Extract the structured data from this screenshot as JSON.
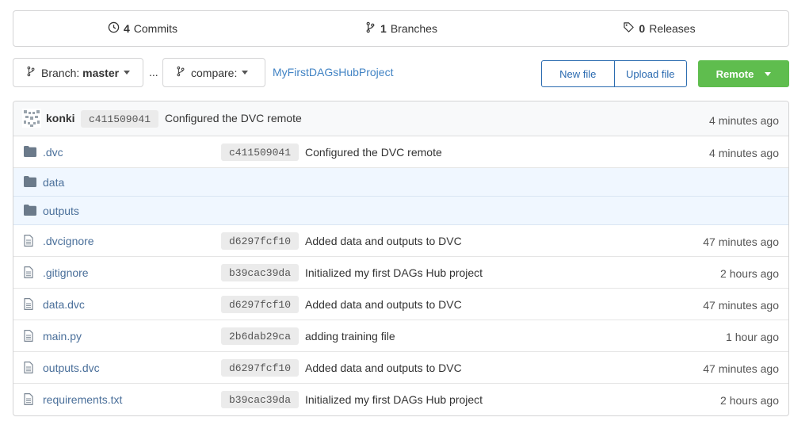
{
  "stats": {
    "commits_count": "4",
    "commits_label": "Commits",
    "branches_count": "1",
    "branches_label": "Branches",
    "releases_count": "0",
    "releases_label": "Releases"
  },
  "toolbar": {
    "branch_prefix": "Branch:",
    "branch_name": "master",
    "ellipsis": "...",
    "compare_label": "compare:",
    "repo_name": "MyFirstDAGsHubProject",
    "new_file": "New file",
    "upload_file": "Upload file",
    "remote": "Remote"
  },
  "latest_commit": {
    "author": "konki",
    "sha": "c411509041",
    "message": "Configured the DVC remote",
    "time": "4 minutes ago"
  },
  "files": [
    {
      "type": "folder",
      "name": ".dvc",
      "sha": "c411509041",
      "message": "Configured the DVC remote",
      "time": "4 minutes ago",
      "highlight": false
    },
    {
      "type": "folder",
      "name": "data",
      "sha": "",
      "message": "",
      "time": "",
      "highlight": true
    },
    {
      "type": "folder",
      "name": "outputs",
      "sha": "",
      "message": "",
      "time": "",
      "highlight": true
    },
    {
      "type": "file",
      "name": ".dvcignore",
      "sha": "d6297fcf10",
      "message": "Added data and outputs to DVC",
      "time": "47 minutes ago",
      "highlight": false
    },
    {
      "type": "file",
      "name": ".gitignore",
      "sha": "b39cac39da",
      "message": "Initialized my first DAGs Hub project",
      "time": "2 hours ago",
      "highlight": false
    },
    {
      "type": "file",
      "name": "data.dvc",
      "sha": "d6297fcf10",
      "message": "Added data and outputs to DVC",
      "time": "47 minutes ago",
      "highlight": false
    },
    {
      "type": "file",
      "name": "main.py",
      "sha": "2b6dab29ca",
      "message": "adding training file",
      "time": "1 hour ago",
      "highlight": false
    },
    {
      "type": "file",
      "name": "outputs.dvc",
      "sha": "d6297fcf10",
      "message": "Added data and outputs to DVC",
      "time": "47 minutes ago",
      "highlight": false
    },
    {
      "type": "file",
      "name": "requirements.txt",
      "sha": "b39cac39da",
      "message": "Initialized my first DAGs Hub project",
      "time": "2 hours ago",
      "highlight": false
    }
  ],
  "colors": {
    "link": "#4183c4",
    "remote_button": "#5fbd4e",
    "highlight_row": "#f0f7ff"
  }
}
